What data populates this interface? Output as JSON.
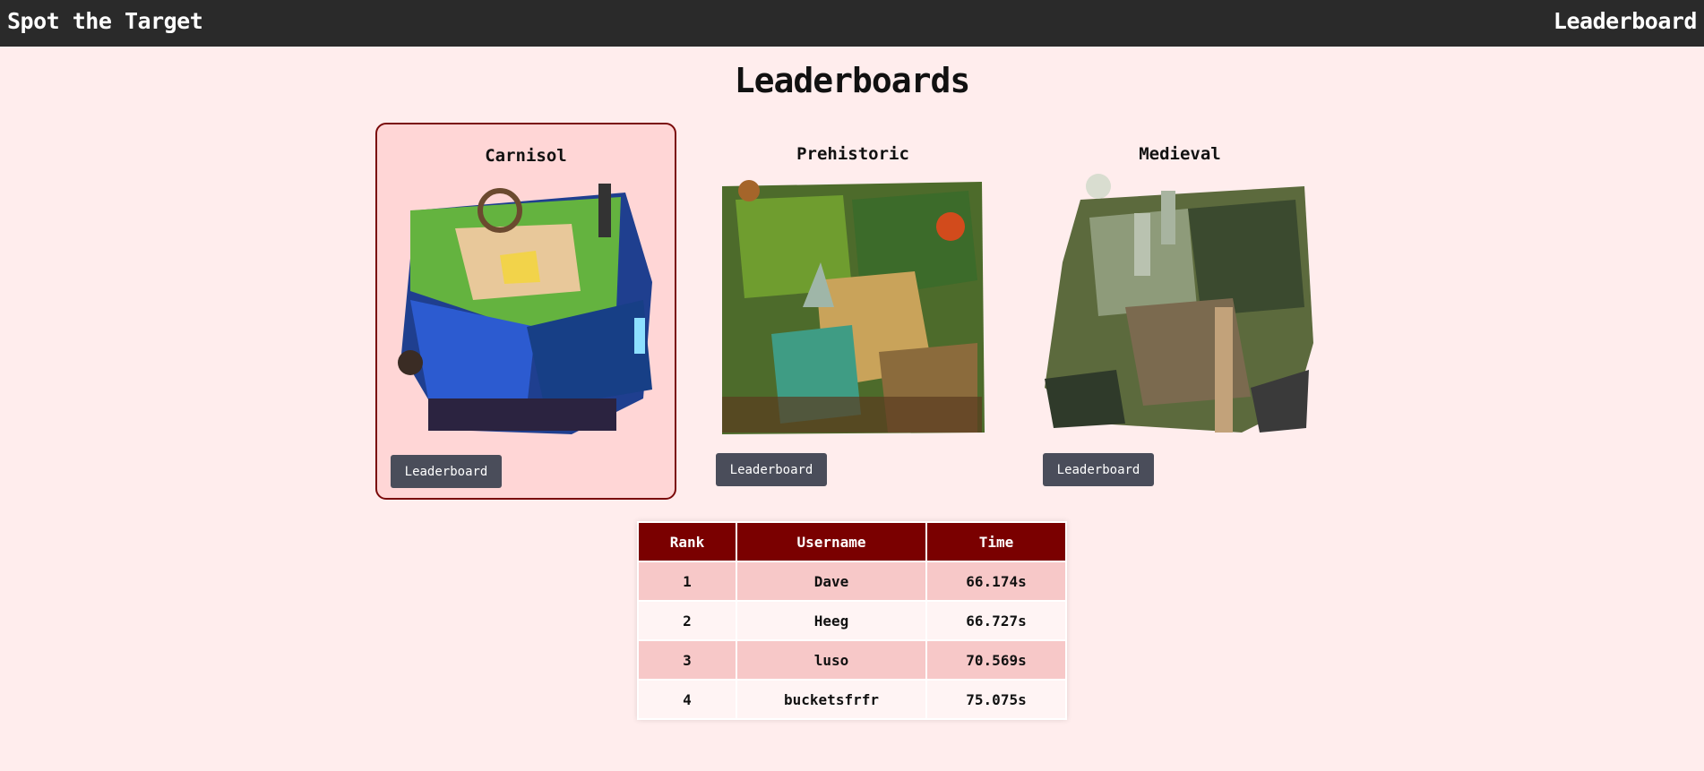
{
  "header": {
    "brand": "Spot the Target",
    "nav_link": "Leaderboard"
  },
  "page": {
    "title": "Leaderboards"
  },
  "maps": [
    {
      "name": "Carnisol",
      "button": "Leaderboard",
      "selected": true
    },
    {
      "name": "Prehistoric",
      "button": "Leaderboard",
      "selected": false
    },
    {
      "name": "Medieval",
      "button": "Leaderboard",
      "selected": false
    }
  ],
  "leaderboard": {
    "columns": [
      "Rank",
      "Username",
      "Time"
    ],
    "rows": [
      {
        "rank": "1",
        "username": "Dave",
        "time": "66.174s"
      },
      {
        "rank": "2",
        "username": "Heeg",
        "time": "66.727s"
      },
      {
        "rank": "3",
        "username": "luso",
        "time": "70.569s"
      },
      {
        "rank": "4",
        "username": "bucketsfrfr",
        "time": "75.075s"
      }
    ]
  },
  "colors": {
    "topbar": "#2a2a2a",
    "page_bg": "#ffeded",
    "accent": "#7a0000",
    "selected_card_bg": "#ffd6d6",
    "button_bg": "#4a4d5a"
  }
}
